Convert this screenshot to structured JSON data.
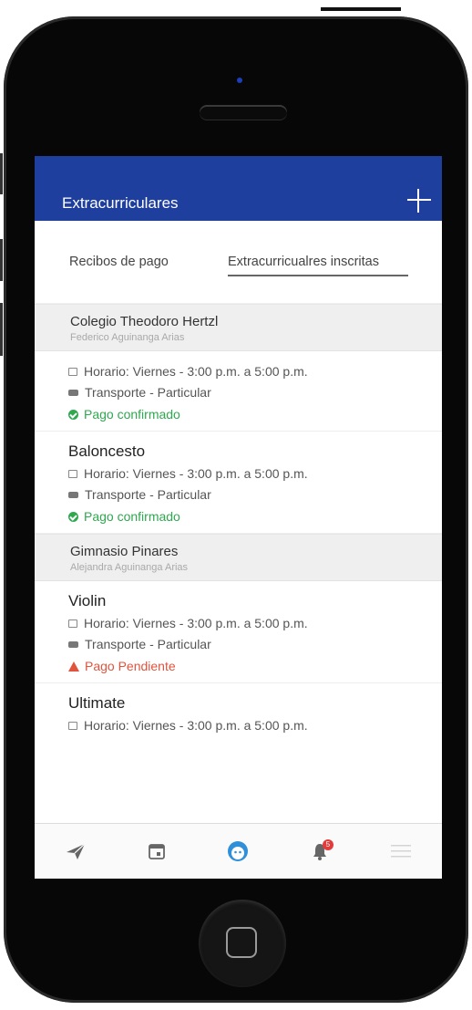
{
  "app": {
    "title": "Extracurriculares"
  },
  "tabs": [
    {
      "label": "Recibos de pago",
      "active": false
    },
    {
      "label": "Extracurricualres inscritas",
      "active": true
    }
  ],
  "groups": [
    {
      "school": "Colegio Theodoro Hertzl",
      "student": "Federico Aguinanga Arias",
      "items": [
        {
          "name": "",
          "schedule": "Horario: Viernes - 3:00 p.m. a 5:00 p.m.",
          "transport": "Transporte - Particular",
          "status": "Pago confirmado",
          "status_type": "ok"
        },
        {
          "name": "Baloncesto",
          "schedule": "Horario: Viernes - 3:00 p.m. a 5:00 p.m.",
          "transport": "Transporte - Particular",
          "status": "Pago confirmado",
          "status_type": "ok"
        }
      ]
    },
    {
      "school": "Gimnasio Pinares",
      "student": "Alejandra Aguinanga Arias",
      "items": [
        {
          "name": "Violin",
          "schedule": "Horario: Viernes - 3:00 p.m. a 5:00 p.m.",
          "transport": "Transporte - Particular",
          "status": "Pago Pendiente",
          "status_type": "warn"
        },
        {
          "name": "Ultimate",
          "schedule": "Horario: Viernes - 3:00 p.m. a 5:00 p.m.",
          "transport": "",
          "status": "",
          "status_type": ""
        }
      ]
    }
  ],
  "bottom_nav": [
    {
      "icon": "send-icon",
      "active": false
    },
    {
      "icon": "calendar-icon",
      "active": false
    },
    {
      "icon": "kid-face-icon",
      "active": true
    },
    {
      "icon": "bell-icon",
      "active": false,
      "badge": "5"
    },
    {
      "icon": "menu-icon",
      "active": false
    }
  ],
  "colors": {
    "header_bg": "#1f3f9e",
    "ok": "#2fa84f",
    "warn": "#e0543e",
    "active_nav": "#2f8fd8",
    "badge": "#e23b3b"
  }
}
